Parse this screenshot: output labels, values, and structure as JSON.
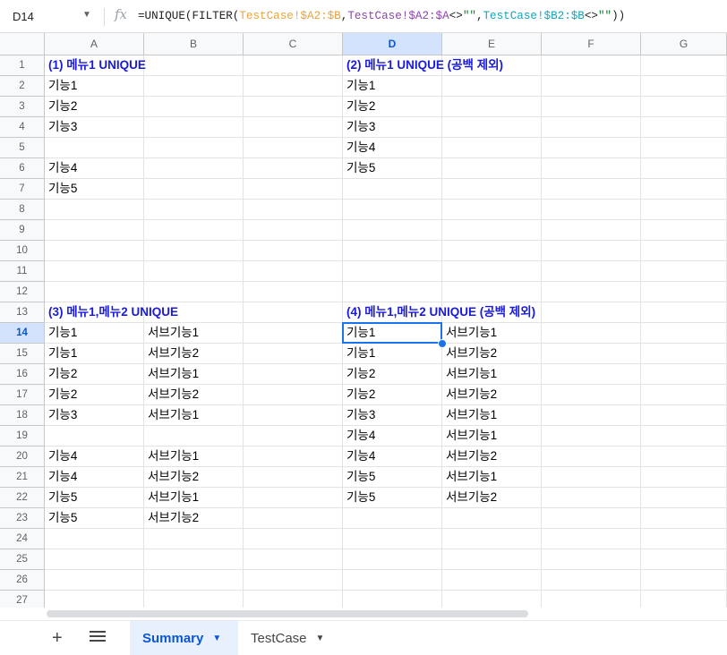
{
  "formula_bar": {
    "cell_ref": "D14",
    "fx": "fx",
    "formula": [
      {
        "t": "=UNIQUE(FILTER(",
        "c": "#202124"
      },
      {
        "t": "TestCase!$A2:$B",
        "c": "#e8a33d"
      },
      {
        "t": ",",
        "c": "#202124"
      },
      {
        "t": "TestCase!$A2:$A",
        "c": "#8e44ad"
      },
      {
        "t": "<>",
        "c": "#202124"
      },
      {
        "t": "\"\"",
        "c": "#188038"
      },
      {
        "t": ",",
        "c": "#202124"
      },
      {
        "t": "TestCase!$B2:$B",
        "c": "#12a4b8"
      },
      {
        "t": "<>",
        "c": "#202124"
      },
      {
        "t": "\"\"",
        "c": "#188038"
      },
      {
        "t": "))",
        "c": "#202124"
      }
    ]
  },
  "columns": [
    "A",
    "B",
    "C",
    "D",
    "E",
    "F",
    "G"
  ],
  "rows": [
    "1",
    "2",
    "3",
    "4",
    "5",
    "6",
    "7",
    "8",
    "9",
    "10",
    "11",
    "12",
    "13",
    "14",
    "15",
    "16",
    "17",
    "18",
    "19",
    "20",
    "21",
    "22",
    "23",
    "24",
    "25",
    "26",
    "27"
  ],
  "selected": {
    "col": "D",
    "row": "14"
  },
  "cells": [
    {
      "r": 1,
      "c": "A",
      "v": "(1) 메뉴1 UNIQUE",
      "style": "blue"
    },
    {
      "r": 1,
      "c": "D",
      "v": "(2) 메뉴1 UNIQUE (공백 제외)",
      "style": "blue"
    },
    {
      "r": 2,
      "c": "A",
      "v": "기능1"
    },
    {
      "r": 2,
      "c": "D",
      "v": "기능1"
    },
    {
      "r": 3,
      "c": "A",
      "v": "기능2"
    },
    {
      "r": 3,
      "c": "D",
      "v": "기능2"
    },
    {
      "r": 4,
      "c": "A",
      "v": "기능3"
    },
    {
      "r": 4,
      "c": "D",
      "v": "기능3"
    },
    {
      "r": 5,
      "c": "D",
      "v": "기능4"
    },
    {
      "r": 6,
      "c": "A",
      "v": "기능4"
    },
    {
      "r": 6,
      "c": "D",
      "v": "기능5"
    },
    {
      "r": 7,
      "c": "A",
      "v": "기능5"
    },
    {
      "r": 13,
      "c": "A",
      "v": "(3) 메뉴1,메뉴2 UNIQUE",
      "style": "blue"
    },
    {
      "r": 13,
      "c": "D",
      "v": "(4) 메뉴1,메뉴2 UNIQUE (공백 제외)",
      "style": "blue"
    },
    {
      "r": 14,
      "c": "A",
      "v": "기능1"
    },
    {
      "r": 14,
      "c": "B",
      "v": "서브기능1"
    },
    {
      "r": 14,
      "c": "D",
      "v": "기능1"
    },
    {
      "r": 14,
      "c": "E",
      "v": "서브기능1"
    },
    {
      "r": 15,
      "c": "A",
      "v": "기능1"
    },
    {
      "r": 15,
      "c": "B",
      "v": "서브기능2"
    },
    {
      "r": 15,
      "c": "D",
      "v": "기능1"
    },
    {
      "r": 15,
      "c": "E",
      "v": "서브기능2"
    },
    {
      "r": 16,
      "c": "A",
      "v": "기능2"
    },
    {
      "r": 16,
      "c": "B",
      "v": "서브기능1"
    },
    {
      "r": 16,
      "c": "D",
      "v": "기능2"
    },
    {
      "r": 16,
      "c": "E",
      "v": "서브기능1"
    },
    {
      "r": 17,
      "c": "A",
      "v": "기능2"
    },
    {
      "r": 17,
      "c": "B",
      "v": "서브기능2"
    },
    {
      "r": 17,
      "c": "D",
      "v": "기능2"
    },
    {
      "r": 17,
      "c": "E",
      "v": "서브기능2"
    },
    {
      "r": 18,
      "c": "A",
      "v": "기능3"
    },
    {
      "r": 18,
      "c": "B",
      "v": "서브기능1"
    },
    {
      "r": 18,
      "c": "D",
      "v": "기능3"
    },
    {
      "r": 18,
      "c": "E",
      "v": "서브기능1"
    },
    {
      "r": 19,
      "c": "D",
      "v": "기능4"
    },
    {
      "r": 19,
      "c": "E",
      "v": "서브기능1"
    },
    {
      "r": 20,
      "c": "A",
      "v": "기능4"
    },
    {
      "r": 20,
      "c": "B",
      "v": "서브기능1"
    },
    {
      "r": 20,
      "c": "D",
      "v": "기능4"
    },
    {
      "r": 20,
      "c": "E",
      "v": "서브기능2"
    },
    {
      "r": 21,
      "c": "A",
      "v": "기능4"
    },
    {
      "r": 21,
      "c": "B",
      "v": "서브기능2"
    },
    {
      "r": 21,
      "c": "D",
      "v": "기능5"
    },
    {
      "r": 21,
      "c": "E",
      "v": "서브기능1"
    },
    {
      "r": 22,
      "c": "A",
      "v": "기능5"
    },
    {
      "r": 22,
      "c": "B",
      "v": "서브기능1"
    },
    {
      "r": 22,
      "c": "D",
      "v": "기능5"
    },
    {
      "r": 22,
      "c": "E",
      "v": "서브기능2"
    },
    {
      "r": 23,
      "c": "A",
      "v": "기능5"
    },
    {
      "r": 23,
      "c": "B",
      "v": "서브기능2"
    }
  ],
  "tabs": [
    {
      "label": "Summary",
      "active": true
    },
    {
      "label": "TestCase",
      "active": false
    }
  ],
  "colors": {
    "accent": "#1a73e8",
    "heading_text": "#1a1adb"
  }
}
